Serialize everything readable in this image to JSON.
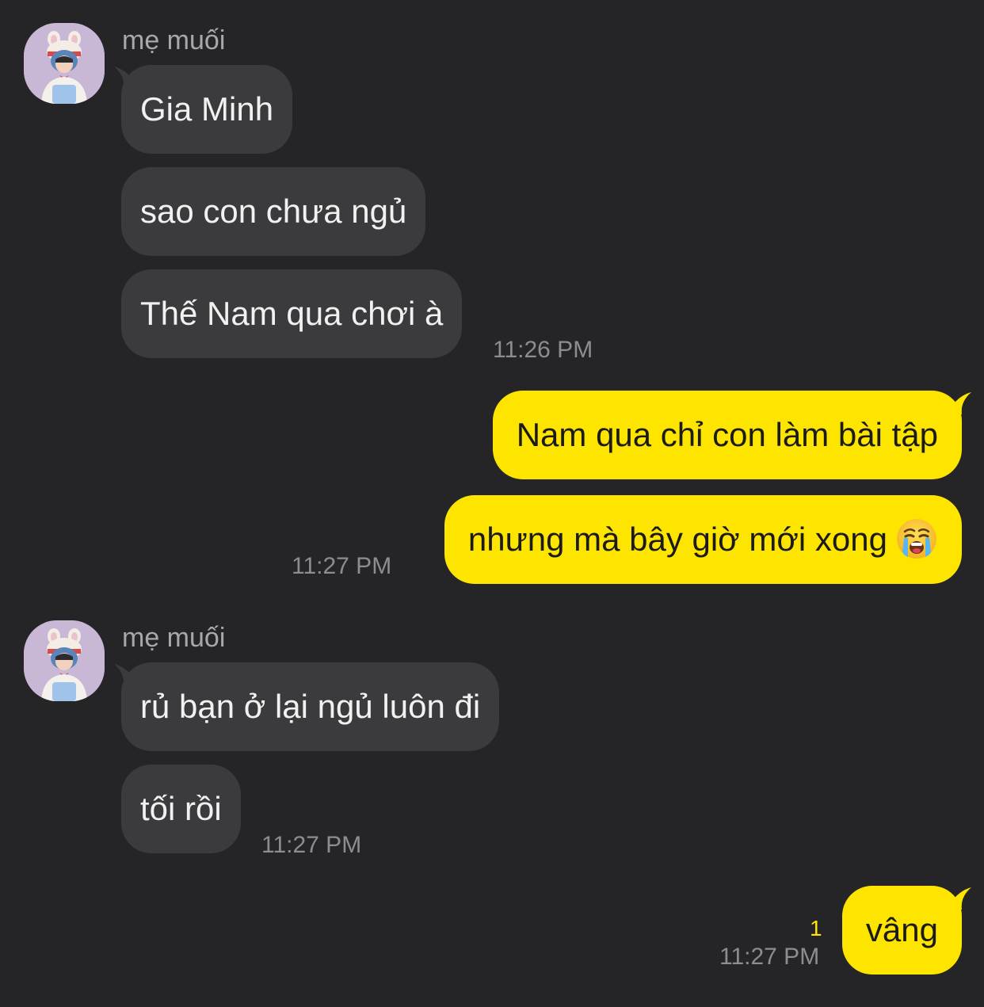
{
  "groups": [
    {
      "sender": "mẹ muối",
      "messages": [
        "Gia Minh",
        "sao con chưa ngủ",
        "Thế Nam qua chơi à"
      ],
      "time": "11:26 PM"
    },
    {
      "outgoing_messages": [
        "Nam qua chỉ con làm bài tập",
        "nhưng mà bây giờ mới xong"
      ],
      "emoji": "loudly-crying-face",
      "time": "11:27 PM"
    },
    {
      "sender": "mẹ muối",
      "messages": [
        "rủ bạn ở lại ngủ luôn đi",
        "tối rồi"
      ],
      "time": "11:27 PM"
    },
    {
      "outgoing_messages": [
        "vâng"
      ],
      "unread_count": "1",
      "time": "11:27 PM"
    }
  ],
  "colors": {
    "background": "#252527",
    "incoming_bubble": "#3b3b3e",
    "outgoing_bubble": "#fee500",
    "timestamp": "#8d8d90"
  }
}
